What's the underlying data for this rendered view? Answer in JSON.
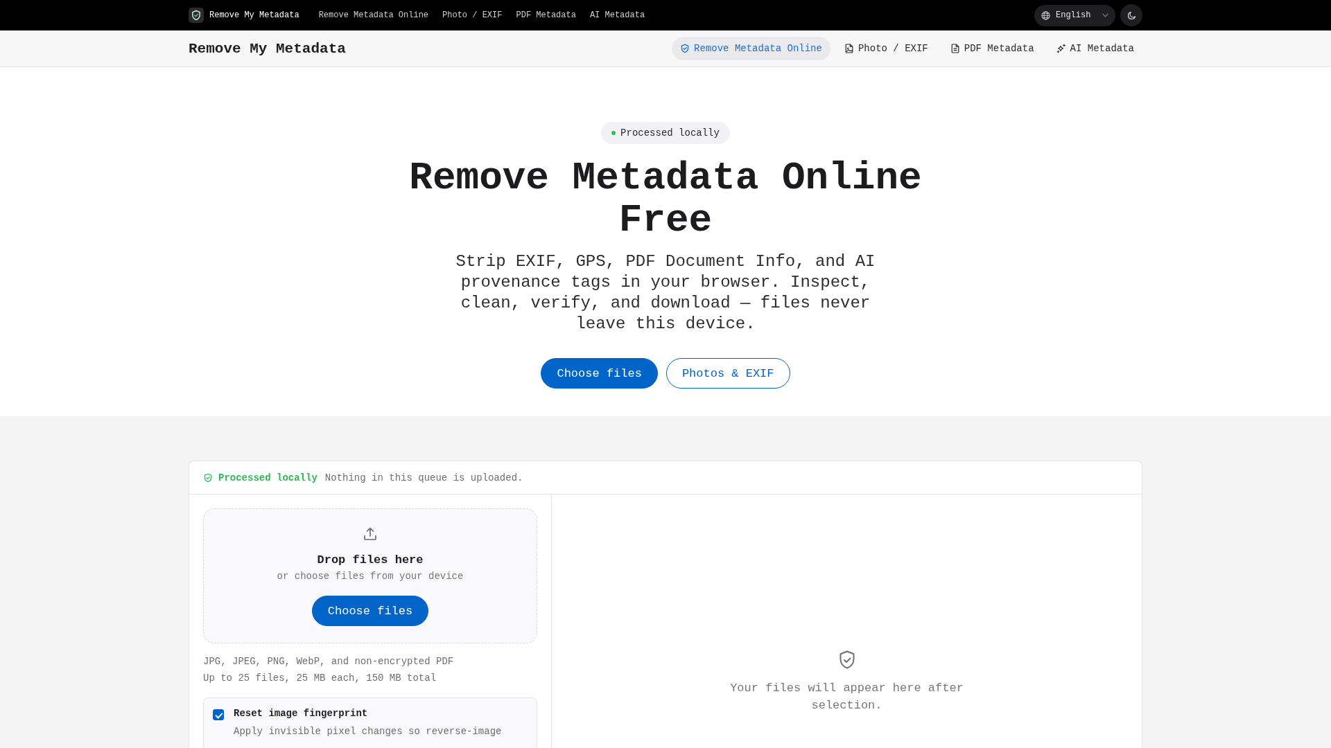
{
  "top_bar": {
    "brand": "Remove My Metadata",
    "links": [
      {
        "label": "Remove Metadata Online"
      },
      {
        "label": "Photo / EXIF"
      },
      {
        "label": "PDF Metadata"
      },
      {
        "label": "AI Metadata"
      }
    ],
    "language": {
      "value": "English"
    }
  },
  "header": {
    "title": "Remove My Metadata",
    "tabs": [
      {
        "label": "Remove Metadata Online",
        "selected": true
      },
      {
        "label": "Photo / EXIF",
        "selected": false
      },
      {
        "label": "PDF Metadata",
        "selected": false
      },
      {
        "label": "AI Metadata",
        "selected": false
      }
    ]
  },
  "hero": {
    "badge": "Processed locally",
    "title": "Remove Metadata Online Free",
    "subtitle": "Strip EXIF, GPS, PDF Document Info, and AI provenance tags in your browser. Inspect, clean, verify, and download — files never leave this device.",
    "buttons": [
      {
        "label": "Choose files",
        "kind": "primary"
      },
      {
        "label": "Photos & EXIF",
        "kind": "outline"
      }
    ]
  },
  "panel": {
    "status": {
      "label": "Processed locally",
      "message": "Nothing in this queue is uploaded."
    },
    "dropzone": {
      "title": "Drop files here",
      "hint": "or choose files from your device",
      "button": "Choose files"
    },
    "notes": [
      "JPG, JPEG, PNG, WebP, and non-encrypted PDF",
      "Up to 25 files, 25 MB each, 150 MB total"
    ],
    "options": [
      {
        "label": "Reset image fingerprint",
        "description": "Apply invisible pixel changes so reverse-image",
        "checked": true
      }
    ],
    "empty_state": "Your files will appear here after selection."
  }
}
